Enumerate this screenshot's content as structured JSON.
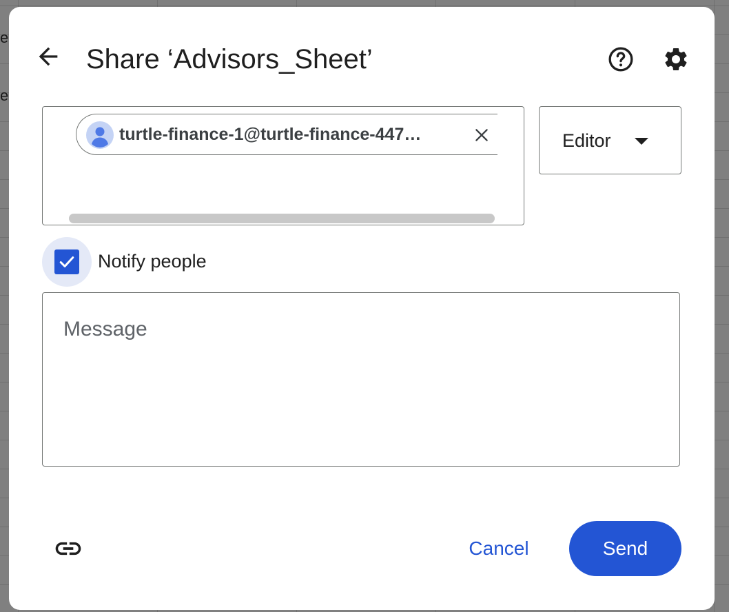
{
  "backdrop": {
    "fragment_1": "eg",
    "fragment_2": "er"
  },
  "dialog": {
    "title": "Share ‘Advisors_Sheet’",
    "icons": {
      "back": "arrow-back-icon",
      "help": "help-circle-icon",
      "settings": "gear-icon",
      "avatar": "person-avatar-icon",
      "chip_remove": "close-icon",
      "role_dropdown": "triangle-down-icon",
      "checkbox": "checkmark-icon",
      "copy_link": "link-icon"
    }
  },
  "recipients": {
    "chips": [
      {
        "email": "turtle-finance-1@turtle-finance-447…"
      }
    ]
  },
  "role": {
    "selected": "Editor"
  },
  "notify": {
    "label": "Notify people",
    "checked": true
  },
  "message": {
    "placeholder": "Message",
    "value": ""
  },
  "footer": {
    "cancel_label": "Cancel",
    "send_label": "Send"
  },
  "colors": {
    "accent": "#2355d4",
    "accent_tint": "#e4e9f7",
    "text": "#1f1f1f",
    "border": "#747775",
    "scrollbar": "#c8c8c8",
    "backdrop": "#808080"
  }
}
